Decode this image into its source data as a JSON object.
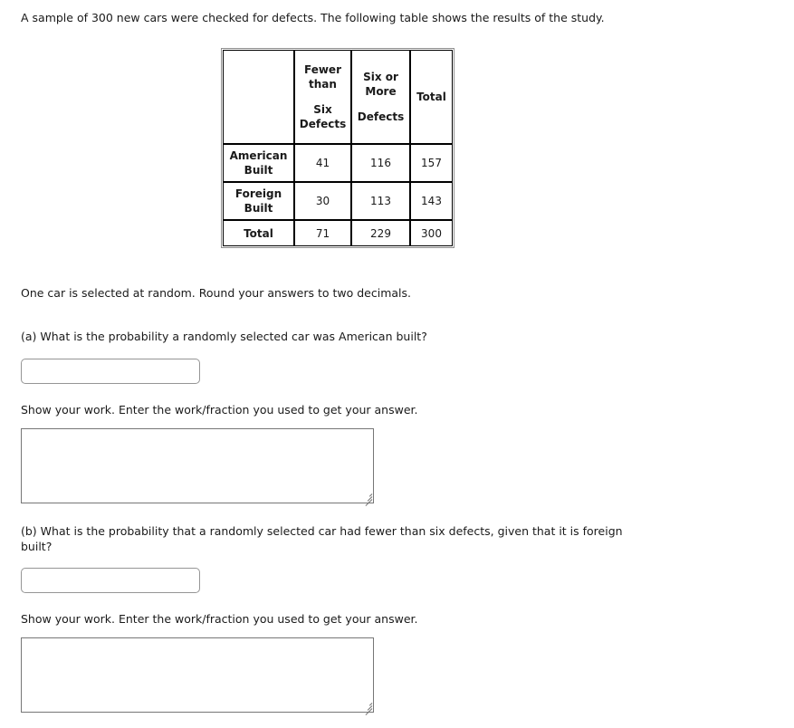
{
  "intro": "A sample of 300 new cars were checked for defects. The following table shows the results of the study.",
  "table": {
    "corner_label": "",
    "headers": [
      {
        "line1": "Fewer",
        "line2": "than",
        "line3": "Six",
        "line4": "Defects"
      },
      {
        "line1": "Six or",
        "line2": "More",
        "line3": "",
        "line4": "Defects"
      },
      {
        "line1": "Total",
        "line2": "",
        "line3": "",
        "line4": ""
      }
    ],
    "rows": [
      {
        "label_line1": "American",
        "label_line2": "Built",
        "fewer": "41",
        "six_or_more": "116",
        "total": "157"
      },
      {
        "label_line1": "Foreign",
        "label_line2": "Built",
        "fewer": "30",
        "six_or_more": "113",
        "total": "143"
      }
    ],
    "total_row": {
      "label": "Total",
      "fewer": "71",
      "six_or_more": "229",
      "total": "300"
    }
  },
  "chart_data": {
    "type": "table",
    "title": "Defects in 300 new cars",
    "column_headers": [
      "",
      "Fewer than Six Defects",
      "Six or More Defects",
      "Total"
    ],
    "row_headers": [
      "American Built",
      "Foreign Built",
      "Total"
    ],
    "values": [
      [
        41,
        116,
        157
      ],
      [
        30,
        113,
        143
      ],
      [
        71,
        229,
        300
      ]
    ]
  },
  "instructions": "One car is selected at random. Round your answers to two decimals.",
  "questions": [
    {
      "prompt": "(a) What is the probability a randomly selected car was American built?",
      "answer_value": "",
      "answer_placeholder": "",
      "work_prompt": "Show your work.  Enter the work/fraction you used to get your answer.",
      "work_value": "",
      "work_placeholder": ""
    },
    {
      "prompt": "(b) What is the probability that a randomly selected car had fewer than six defects, given that it is foreign built?",
      "answer_value": "",
      "answer_placeholder": "",
      "work_prompt": "Show your work.  Enter the work/fraction you used to get your answer.",
      "work_value": "",
      "work_placeholder": ""
    }
  ],
  "colors": {
    "text": "#1a1a1a",
    "table_inner_border": "#000000",
    "table_outer_border": "#8f8f8f",
    "input_border": "#959595",
    "textarea_border": "#767676",
    "background": "#ffffff"
  }
}
